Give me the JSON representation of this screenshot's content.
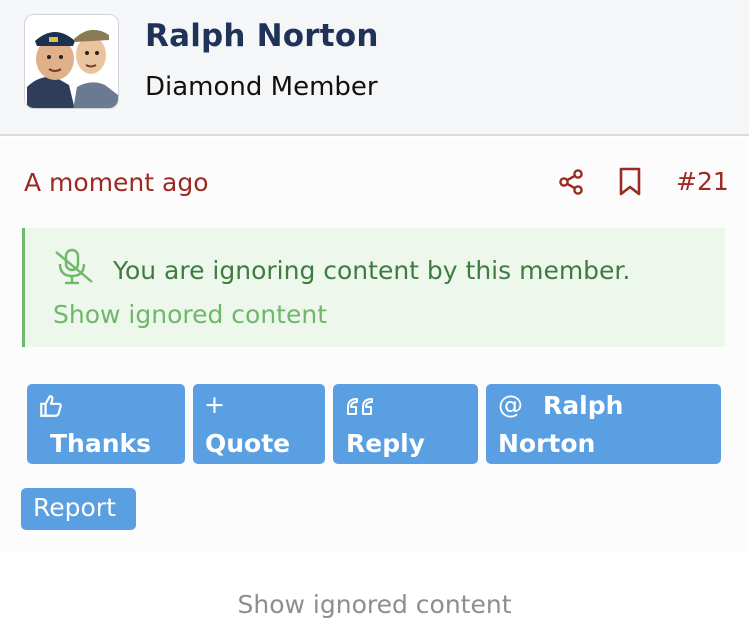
{
  "member": {
    "name": "Ralph Norton",
    "title": "Diamond Member"
  },
  "post": {
    "time": "A moment ago",
    "number": "#21"
  },
  "ignored_notice": {
    "message": "You are ignoring content by this member.",
    "link": "Show ignored content"
  },
  "actions": {
    "thanks": "Thanks",
    "quote": "Quote",
    "reply": "Reply",
    "mention_line1": "Ralph",
    "mention_line2": "Norton",
    "mention_symbol": "@",
    "quote_symbol": "+",
    "report": "Report"
  },
  "footer": {
    "show_ignored": "Show ignored content"
  },
  "colors": {
    "accent_blue": "#5a9fe2",
    "time_red": "#9c2a22",
    "notice_green": "#3f7c3f",
    "name_navy": "#1e3357"
  },
  "icons": [
    "share-icon",
    "bookmark-icon",
    "mute-icon",
    "thumbs-up-icon",
    "plus-icon",
    "quote-marks-icon",
    "at-icon"
  ]
}
